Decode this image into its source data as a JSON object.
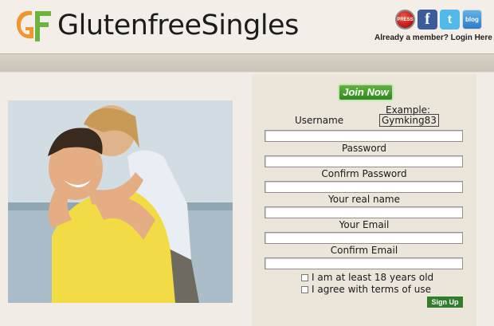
{
  "header": {
    "brand": "GlutenfreeSingles",
    "logo_mark": "GF",
    "member_link": "Already a member? Login Here",
    "social": [
      {
        "name": "press-icon",
        "glyph": "PRESS"
      },
      {
        "name": "facebook-icon",
        "glyph": "f"
      },
      {
        "name": "twitter-icon",
        "glyph": "t"
      },
      {
        "name": "blog-icon",
        "glyph": "blog"
      }
    ]
  },
  "form": {
    "join_label": "Join Now",
    "example_label": "Example:",
    "example_value": "Gymking83",
    "fields": {
      "username": "Username",
      "password": "Password",
      "confirm_password": "Confirm Password",
      "real_name": "Your real name",
      "email": "Your Email",
      "confirm_email": "Confirm Email"
    },
    "age_check": "I am at least 18 years old",
    "terms_check": "I agree with terms of use",
    "signup_label": "Sign Up"
  },
  "colors": {
    "brand_orange": "#f0962c",
    "brand_green": "#5fb23d",
    "signup_green": "#2f7d2d"
  }
}
